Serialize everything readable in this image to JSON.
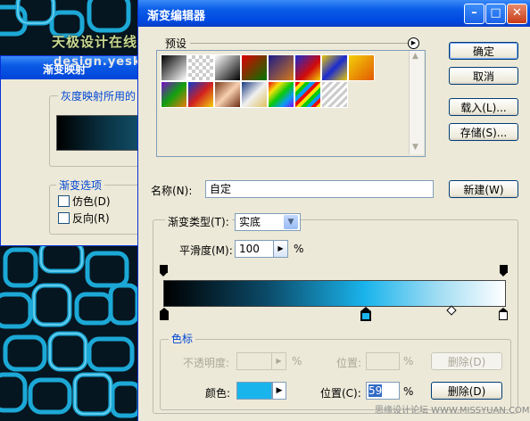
{
  "watermark_top": "天极设计在线",
  "watermark_mid": "design.yesky.com",
  "watermark_bottom": "思缘设计论坛 WWW.MISSYUAN.COM",
  "back_dialog": {
    "title": "渐变映射",
    "group_label": "灰度映射所用的",
    "options_group": "渐变选项",
    "dither_label": "仿色(D)",
    "reverse_label": "反向(R)"
  },
  "dialog": {
    "title": "渐变编辑器",
    "presets_label": "预设",
    "buttons": {
      "ok": "确定",
      "cancel": "取消",
      "load": "载入(L)...",
      "save": "存储(S)...",
      "new": "新建(W)",
      "delete_opacity": "删除(D)",
      "delete_color": "删除(D)"
    },
    "name_label": "名称(N):",
    "name_value": "自定",
    "gradient_type_label": "渐变类型(T):",
    "gradient_type_value": "实底",
    "smoothness_label": "平滑度(M):",
    "smoothness_value": "100",
    "smoothness_unit": "%",
    "stops_group": "色标",
    "opacity_label": "不透明度:",
    "opacity_unit": "%",
    "opacity_location_label": "位置:",
    "opacity_location_unit": "%",
    "color_label": "颜色:",
    "color_location_label": "位置(C):",
    "color_location_value": "59",
    "color_location_unit": "%"
  },
  "colors": {
    "accent_stop": "#1ab4ec",
    "gradient_start": "#000000",
    "gradient_mid": "#1ab4ec",
    "gradient_end": "#ffffff",
    "xp_title": "#0a5ae6"
  },
  "icons": [
    "minimize-icon",
    "maximize-icon",
    "close-icon",
    "menu-arrow-icon",
    "dropdown-arrow-icon",
    "slider-arrow-icon",
    "color-picker-arrow-icon",
    "checkbox-icon"
  ]
}
